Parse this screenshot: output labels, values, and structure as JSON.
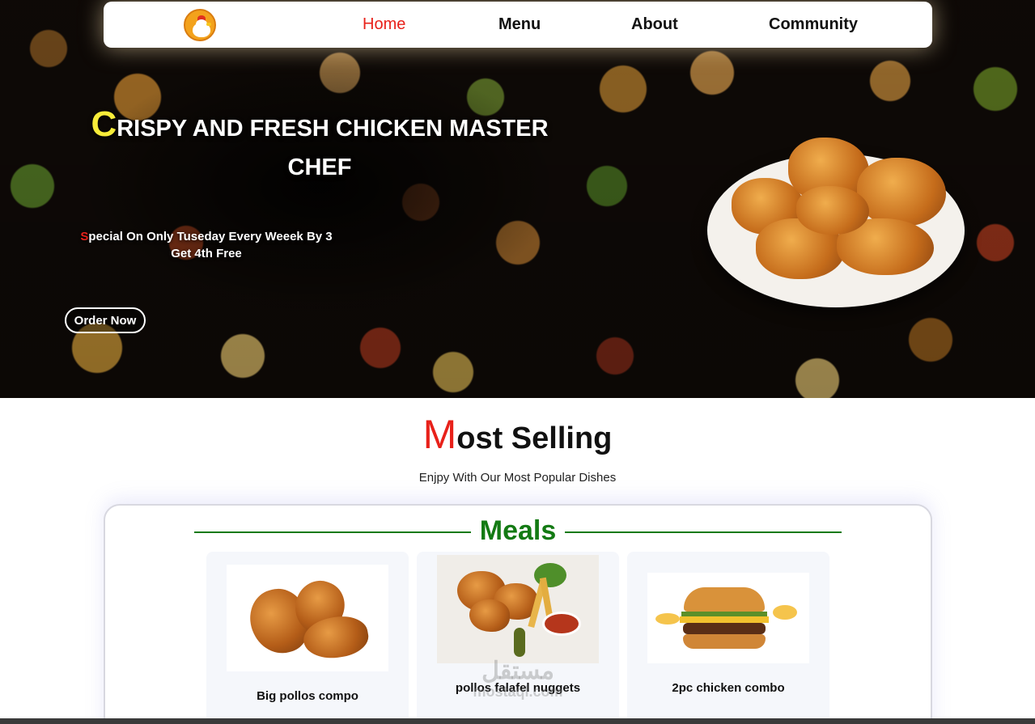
{
  "nav": {
    "logo_icon": "rooster-logo-icon",
    "links": [
      "Home",
      "Menu",
      "About",
      "Community"
    ],
    "active": "Home"
  },
  "hero": {
    "title_first": "C",
    "title_rest": "RISPY AND FRESH CHICKEN MASTER",
    "title_line2": "CHEF",
    "sub_first": "S",
    "sub_rest": "pecial On Only Tuseday Every Weeek By 3",
    "sub_line2": "Get 4th Free",
    "order_button": "Order Now"
  },
  "most_selling": {
    "title_first": "M",
    "title_rest": "ost Selling",
    "subtitle": "Enjpy With Our Most Popular Dishes"
  },
  "meals": {
    "heading": "Meals",
    "items": [
      {
        "name": "Big pollos compo"
      },
      {
        "name": "pollos falafel nuggets"
      },
      {
        "name": "2pc chicken combo"
      }
    ]
  },
  "watermark": {
    "arabic": "مستقل",
    "latin": "mostaql.com"
  },
  "colors": {
    "accent_red": "#e8211a",
    "accent_yellow": "#f7ec39",
    "meals_green": "#137a13"
  }
}
